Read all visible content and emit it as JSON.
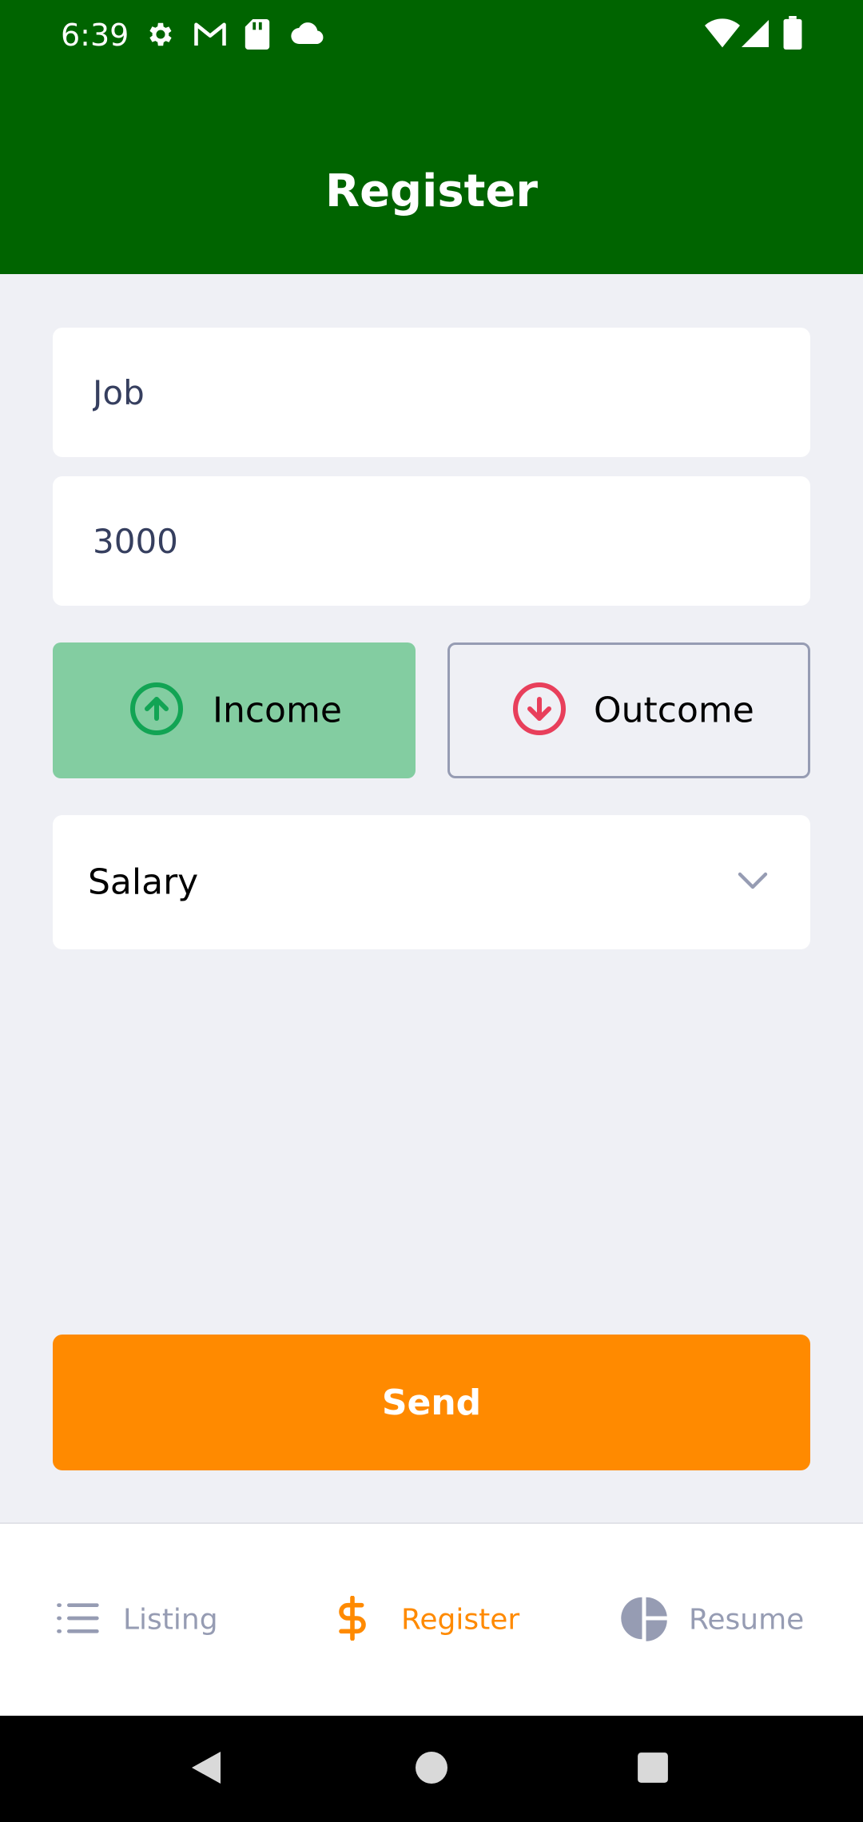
{
  "status_bar": {
    "time": "6:39",
    "left_icons": [
      "gear-icon",
      "gmail-icon",
      "sd-card-icon",
      "cloud-icon"
    ],
    "right_icons": [
      "wifi-icon",
      "cell-signal-icon",
      "battery-icon"
    ]
  },
  "header": {
    "title": "Register",
    "background": "#006400"
  },
  "form": {
    "name_field": {
      "value": "Job",
      "placeholder": ""
    },
    "amount_field": {
      "value": "3000",
      "placeholder": ""
    },
    "type_buttons": {
      "income": {
        "label": "Income",
        "icon": "arrow-up-circle-icon",
        "selected": true,
        "color": "#12A454"
      },
      "outcome": {
        "label": "Outcome",
        "icon": "arrow-down-circle-icon",
        "selected": false,
        "color": "#E83F5B"
      }
    },
    "category_select": {
      "value": "Salary",
      "icon": "chevron-down-icon"
    },
    "send_label": "Send"
  },
  "tabbar": {
    "tabs": [
      {
        "label": "Listing",
        "icon": "list-icon",
        "active": false
      },
      {
        "label": "Register",
        "icon": "dollar-sign-icon",
        "active": true
      },
      {
        "label": "Resume",
        "icon": "pie-chart-icon",
        "active": false
      }
    ],
    "active_color": "#FF8A00",
    "inactive_color": "#969CB3"
  },
  "android_nav": {
    "buttons": [
      "back-icon",
      "home-icon",
      "recents-icon"
    ]
  }
}
